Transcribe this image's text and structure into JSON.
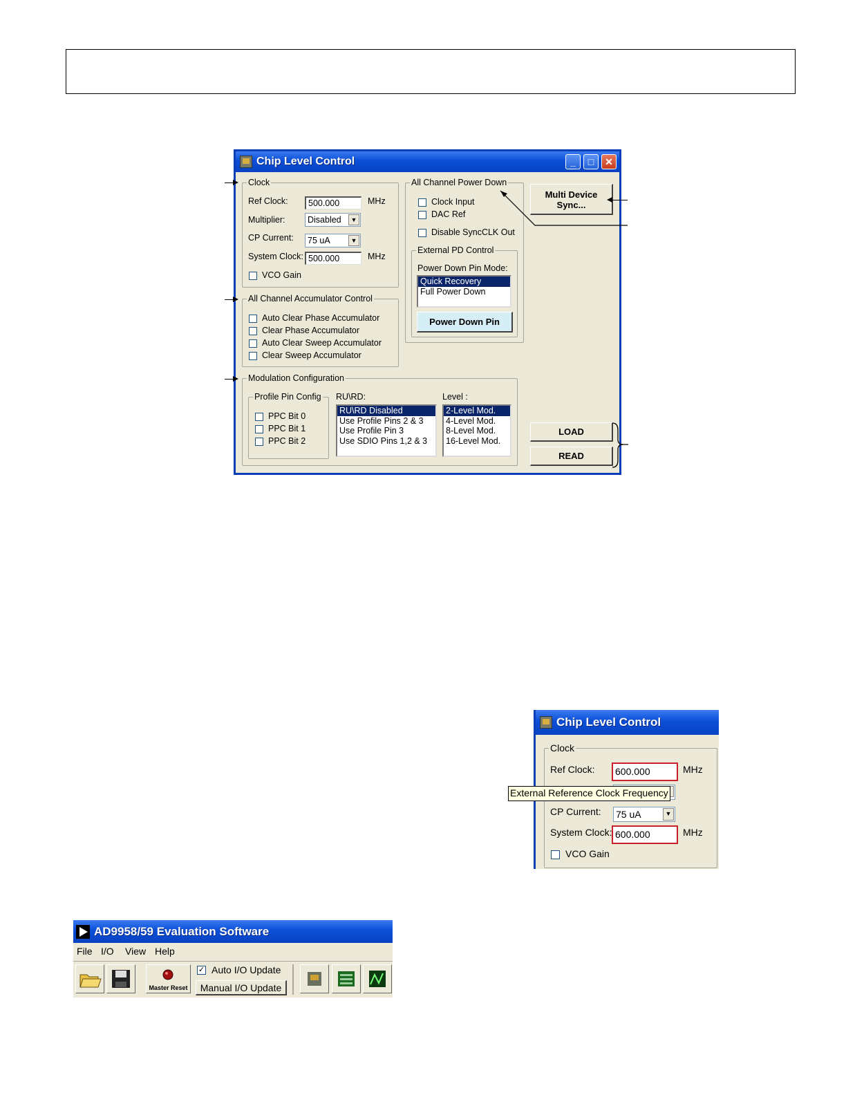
{
  "main_window": {
    "title": "Chip Level Control",
    "clock": {
      "legend": "Clock",
      "ref_clock_label": "Ref Clock:",
      "ref_clock_value": "500.000",
      "ref_clock_unit": "MHz",
      "multiplier_label": "Multiplier:",
      "multiplier_value": "Disabled",
      "cp_current_label": "CP Current:",
      "cp_current_value": "75 uA",
      "system_clock_label": "System Clock:",
      "system_clock_value": "500.000",
      "system_clock_unit": "MHz",
      "vco_gain_label": "VCO Gain"
    },
    "accumulator": {
      "legend": "All Channel Accumulator Control",
      "items": [
        "Auto Clear Phase Accumulator",
        "Clear Phase Accumulator",
        "Auto Clear Sweep Accumulator",
        "Clear Sweep Accumulator"
      ]
    },
    "power_down": {
      "legend": "All Channel Power Down",
      "clock_input": "Clock Input",
      "dac_ref": "DAC Ref",
      "disable_syncclk": "Disable SyncCLK Out",
      "ext_pd_legend": "External PD Control",
      "pin_mode_label": "Power Down Pin Mode:",
      "modes": [
        "Quick Recovery",
        "Full Power Down"
      ],
      "power_down_pin_button": "Power Down Pin"
    },
    "multi_device_sync": {
      "line1": "Multi Device",
      "line2": "Sync..."
    },
    "modulation": {
      "legend": "Modulation Configuration",
      "profile_pin_legend": "Profile Pin Config",
      "ppc": [
        "PPC Bit 0",
        "PPC Bit 1",
        "PPC Bit 2"
      ],
      "rurd_label": "RU\\RD:",
      "rurd_options": [
        "RU\\RD Disabled",
        "Use Profile Pins 2 & 3",
        "Use Profile Pin 3",
        "Use SDIO Pins 1,2 & 3"
      ],
      "level_label": "Level :",
      "level_options": [
        "2-Level Mod.",
        "4-Level Mod.",
        "8-Level Mod.",
        "16-Level Mod."
      ]
    },
    "load_button": "LOAD",
    "read_button": "READ"
  },
  "detail_window": {
    "title": "Chip Level Control",
    "clock_legend": "Clock",
    "ref_clock_label": "Ref Clock:",
    "ref_clock_value": "600.000",
    "unit": "MHz",
    "tooltip": "External Reference Clock Frequency",
    "cp_current_label": "CP Current:",
    "cp_current_value": "75 uA",
    "system_clock_label": "System Clock:",
    "system_clock_value": "600.000",
    "vco_gain_label": "VCO Gain",
    "highlight_color": "#c8202a"
  },
  "eval_window": {
    "title": "AD9958/59 Evaluation Software",
    "menu": [
      "File",
      "I/O",
      "View",
      "Help"
    ],
    "master_reset_label": "Master Reset",
    "auto_io_update": "Auto I/O Update",
    "manual_io_update": "Manual I/O Update",
    "icons": [
      "open-folder-icon",
      "save-icon",
      "chip-level-icon",
      "channel-icon",
      "sweep-icon"
    ]
  }
}
